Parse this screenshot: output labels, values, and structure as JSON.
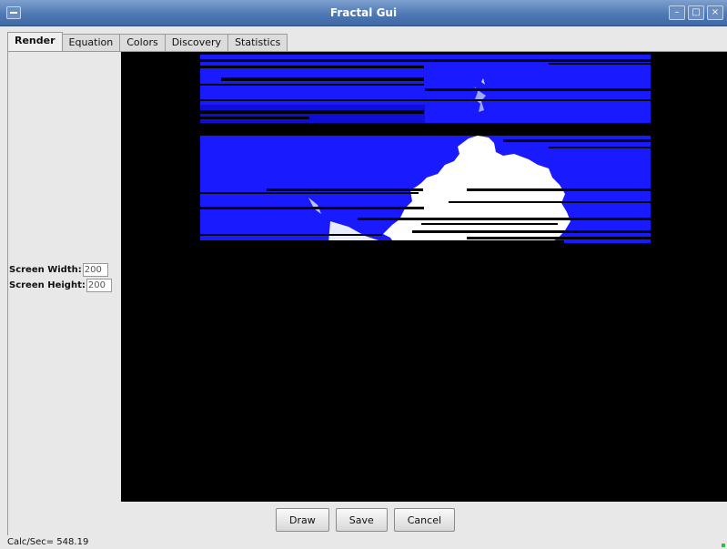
{
  "window": {
    "title": "Fractal Gui",
    "controls": {
      "minimize": "–",
      "maximize": "□",
      "close": "×"
    }
  },
  "tabs": [
    {
      "label": "Render",
      "active": true
    },
    {
      "label": "Equation",
      "active": false
    },
    {
      "label": "Colors",
      "active": false
    },
    {
      "label": "Discovery",
      "active": false
    },
    {
      "label": "Statistics",
      "active": false
    }
  ],
  "render": {
    "screen_width": {
      "label": "Screen Width:",
      "value": "200"
    },
    "screen_height": {
      "label": "Screen Height:",
      "value": "200"
    }
  },
  "buttons": {
    "draw": "Draw",
    "save": "Save",
    "cancel": "Cancel"
  },
  "status": {
    "calc_rate": "Calc/Sec= 548.19"
  },
  "colors": {
    "title_bar": "#4f79b4",
    "canvas_bg": "#000000",
    "fractal_fill": "#1a1aff",
    "fractal_set": "#ffffff",
    "status_led": "#2fbf3a"
  },
  "icons": [
    "window-menu-icon",
    "minimize-icon",
    "maximize-icon",
    "close-icon"
  ]
}
